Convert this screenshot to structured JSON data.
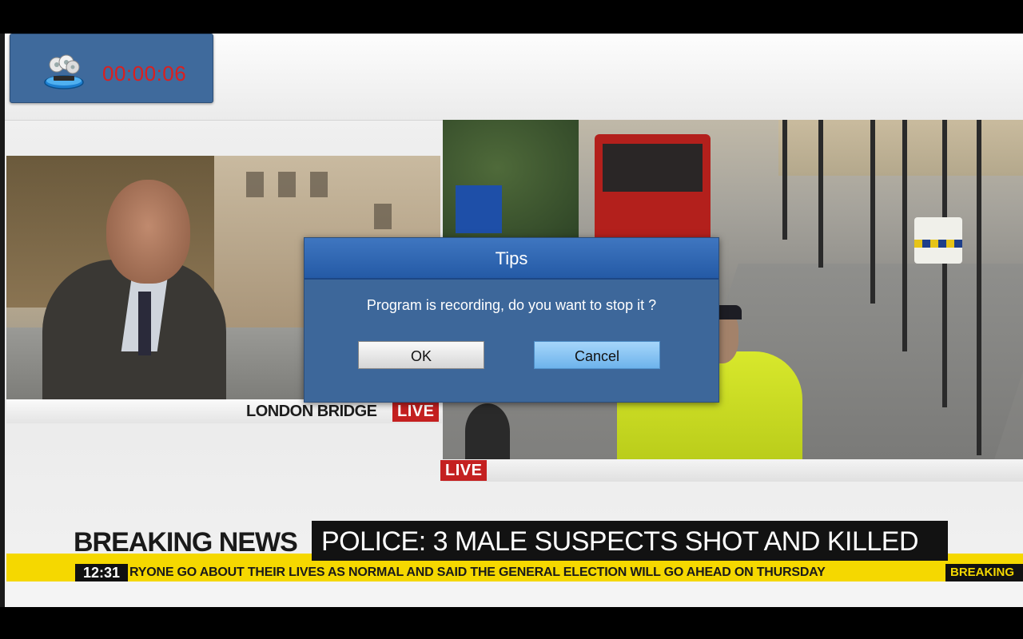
{
  "recording": {
    "elapsed": "00:00:06",
    "icon": "recorder-disc-icon"
  },
  "left_feed": {
    "location": "LONDON BRIDGE",
    "live_label": "LIVE"
  },
  "right_feed": {
    "live_label": "LIVE"
  },
  "dialog": {
    "title": "Tips",
    "message": "Program is recording, do you want to stop it ?",
    "ok_label": "OK",
    "cancel_label": "Cancel"
  },
  "news": {
    "breaking_label": "BREAKING NEWS",
    "headline": "POLICE: 3 MALE SUSPECTS SHOT AND KILLED",
    "clock": "12:31",
    "ticker": "RYONE GO ABOUT THEIR LIVES AS NORMAL AND SAID THE GENERAL ELECTION WILL GO AHEAD ON THURSDAY",
    "ticker_tail": "BREAKING"
  },
  "colors": {
    "breaking_yellow": "#f5d800",
    "live_red": "#c42020",
    "dialog_blue": "#3d679a",
    "recording_red": "#d92020"
  }
}
